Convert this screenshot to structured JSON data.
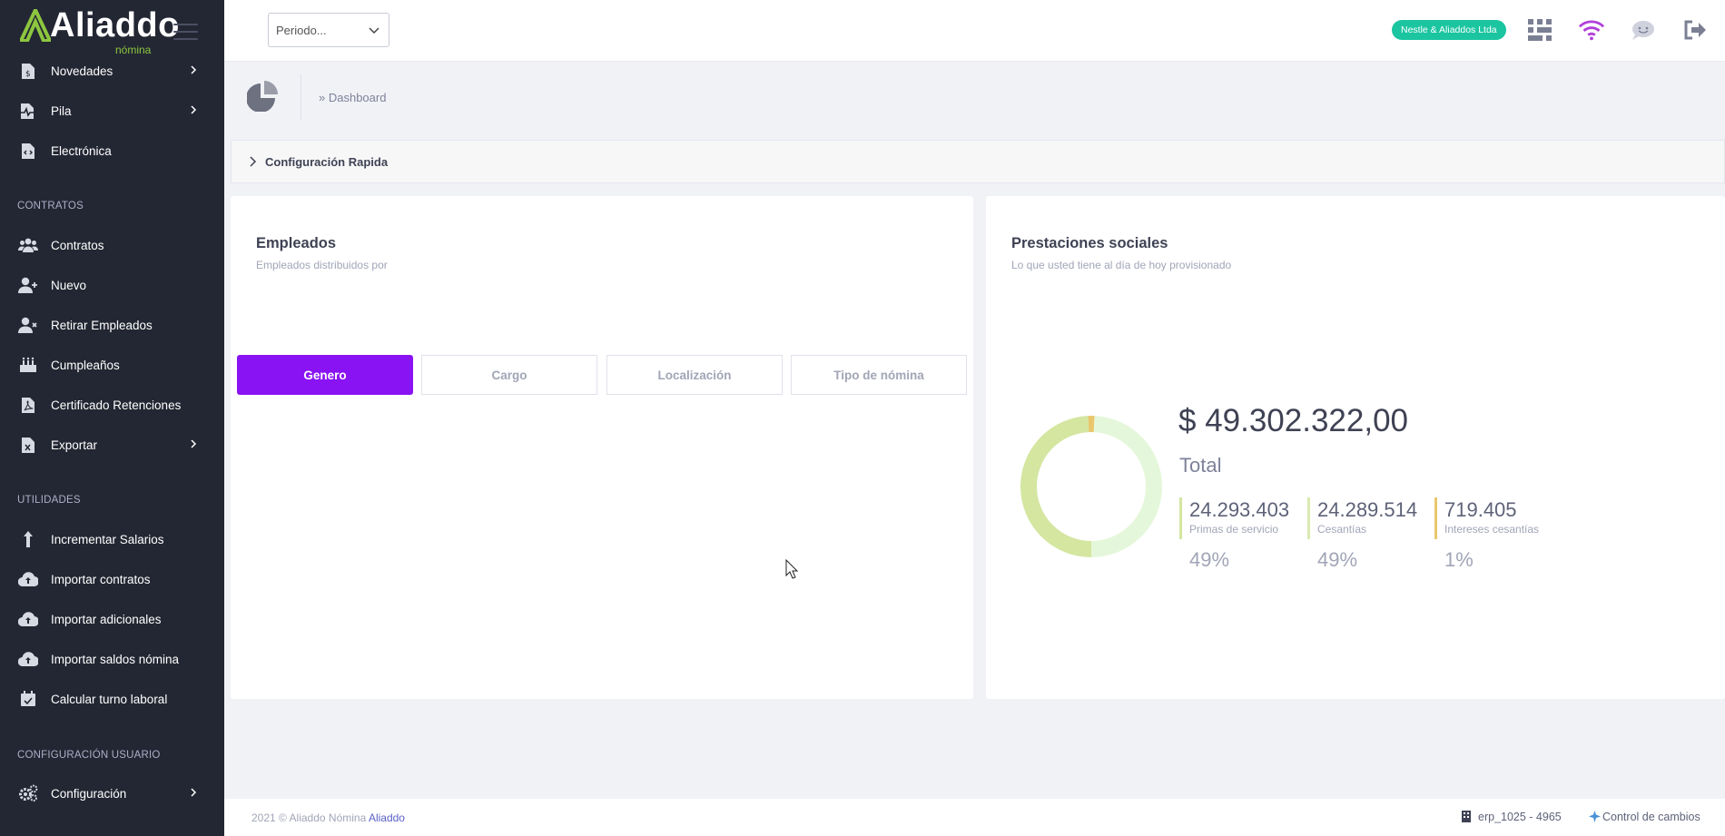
{
  "brand": {
    "logo_text": "Aliaddo",
    "logo_sub": "nómina"
  },
  "sidebar": {
    "items_top": [
      {
        "label": "Novedades",
        "icon": "dollar-doc-icon",
        "has_submenu": true
      },
      {
        "label": "Pila",
        "icon": "pulse-doc-icon",
        "has_submenu": true
      },
      {
        "label": "Electrónica",
        "icon": "code-doc-icon",
        "has_submenu": false
      }
    ],
    "section_contratos": "CONTRATOS",
    "items_contratos": [
      {
        "label": "Contratos",
        "icon": "users-icon"
      },
      {
        "label": "Nuevo",
        "icon": "user-plus-icon"
      },
      {
        "label": "Retirar Empleados",
        "icon": "user-remove-icon"
      },
      {
        "label": "Cumpleaños",
        "icon": "cake-icon"
      },
      {
        "label": "Certificado Retenciones",
        "icon": "pdf-doc-icon"
      },
      {
        "label": "Exportar",
        "icon": "excel-doc-icon",
        "has_submenu": true
      }
    ],
    "section_utilidades": "UTILIDADES",
    "items_utilidades": [
      {
        "label": "Incrementar Salarios",
        "icon": "arrow-up-icon"
      },
      {
        "label": "Importar contratos",
        "icon": "cloud-upload-icon"
      },
      {
        "label": "Importar adicionales",
        "icon": "cloud-upload-icon"
      },
      {
        "label": "Importar saldos nómina",
        "icon": "cloud-upload-icon"
      },
      {
        "label": "Calcular turno laboral",
        "icon": "calendar-icon"
      }
    ],
    "section_config": "CONFIGURACIÓN USUARIO",
    "items_config": [
      {
        "label": "Configuración",
        "icon": "gears-icon",
        "has_submenu": true
      }
    ]
  },
  "topbar": {
    "period_placeholder": "Periodo...",
    "company": "Nestle & Aliaddos Ltda",
    "icons": [
      "apps-grid-icon",
      "wifi-icon",
      "chat-icon",
      "logout-icon"
    ],
    "colors": {
      "wifi": "#b03fd9",
      "badge": "#1bc5a0"
    }
  },
  "breadcrumb": {
    "text": "» Dashboard"
  },
  "config_rapida": {
    "label": "Configuración Rapida"
  },
  "empleados": {
    "title": "Empleados",
    "subtitle": "Empleados distribuidos por",
    "tabs": [
      "Genero",
      "Cargo",
      "Localización",
      "Tipo de nómina"
    ],
    "active_tab": "Genero",
    "accent": "#8913f2"
  },
  "prestaciones": {
    "title": "Prestaciones sociales",
    "subtitle": "Lo que usted tiene al día de hoy provisionado",
    "total_amount": "$ 49.302.322,00",
    "total_label": "Total",
    "stats": [
      {
        "value": "24.293.403",
        "label": "Primas de servicio",
        "pct": "49%",
        "color": "#d4e6a0"
      },
      {
        "value": "24.289.514",
        "label": "Cesantías",
        "pct": "49%",
        "color": "#e5f7da"
      },
      {
        "value": "719.405",
        "label": "Intereses cesantías",
        "pct": "1%",
        "color": "#e8c76e"
      }
    ],
    "donut_fractions": [
      0.4927,
      0.4927,
      0.0146
    ]
  },
  "footer": {
    "copy_prefix": "2021 © Aliaddo Nómina ",
    "copy_link": "Aliaddo",
    "erp": "erp_1025 - 4965",
    "changes": "Control de cambios"
  }
}
